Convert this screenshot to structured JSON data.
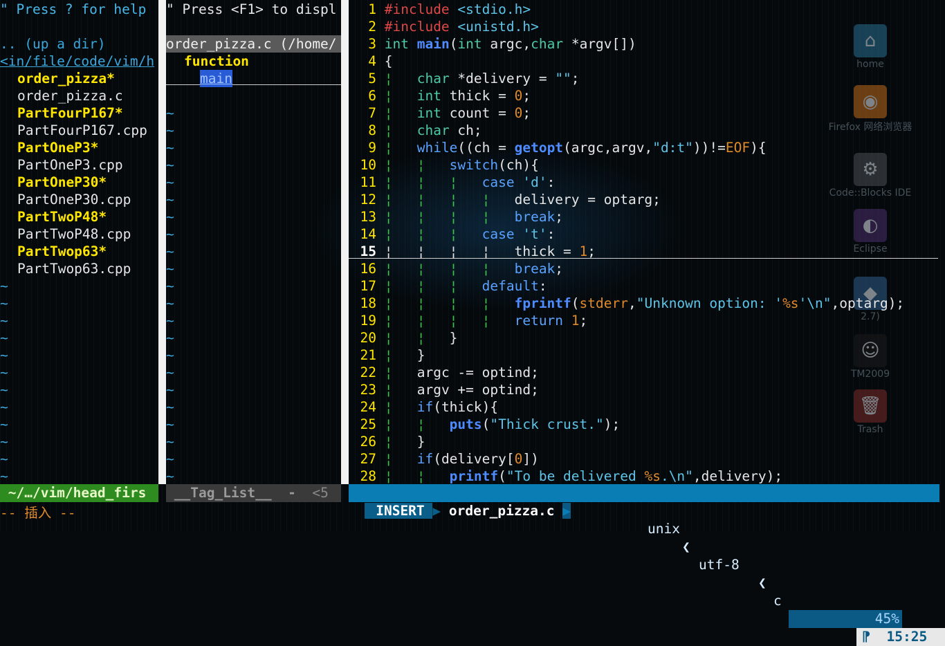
{
  "nerdtree": {
    "help": "\" Press ? for help",
    "up_dir": ".. (up a dir)",
    "cwd": "<in/file/code/vim/h",
    "entries": [
      {
        "name": "order_pizza*",
        "exec": true
      },
      {
        "name": "order_pizza.c",
        "exec": false
      },
      {
        "name": "PartFourP167*",
        "exec": true
      },
      {
        "name": "PartFourP167.cpp",
        "exec": false
      },
      {
        "name": "PartOneP3*",
        "exec": true
      },
      {
        "name": "PartOneP3.cpp",
        "exec": false
      },
      {
        "name": "PartOneP30*",
        "exec": true
      },
      {
        "name": "PartOneP30.cpp",
        "exec": false
      },
      {
        "name": "PartTwoP48*",
        "exec": true
      },
      {
        "name": "PartTwoP48.cpp",
        "exec": false
      },
      {
        "name": "PartTwop63*",
        "exec": true
      },
      {
        "name": "PartTwop63.cpp",
        "exec": false
      }
    ],
    "tilde": "~"
  },
  "taglist": {
    "help": "\" Press <F1> to displ",
    "file": "order_pizza.c (/home/",
    "kind": "function",
    "tag": "main"
  },
  "statusline": {
    "nerdtree_path": " ~/…/vim/head_firs",
    "taglist_name": " __Tag_List__  - ",
    "taglist_pos": " <5",
    "mode": " INSERT ",
    "filename": " order_pizza.c ",
    "fileformat": "unix",
    "encoding": "utf-8",
    "filetype": "c",
    "percent": "45%",
    "position": "15:25"
  },
  "cmdline": "-- 插入 --",
  "desktop_icons": [
    {
      "name": "home-icon",
      "label": "home"
    },
    {
      "name": "firefox-icon",
      "label": "Firefox 网络浏览器"
    },
    {
      "name": "codeblocks-icon",
      "label": "Code::Blocks IDE"
    },
    {
      "name": "eclipse-icon",
      "label": "Eclipse"
    },
    {
      "name": "idle-icon",
      "label": "2.7)"
    },
    {
      "name": "qq-icon",
      "label": "TM2009"
    },
    {
      "name": "trash-icon",
      "label": "Trash"
    }
  ],
  "code": [
    [
      [
        "pre",
        "#include "
      ],
      [
        "str",
        "<stdio.h>"
      ]
    ],
    [
      [
        "pre",
        "#include "
      ],
      [
        "str",
        "<unistd.h>"
      ]
    ],
    [
      [
        "typ",
        "int "
      ],
      [
        "fn",
        "main"
      ],
      [
        "",
        "("
      ],
      [
        "typ",
        "int"
      ],
      [
        "",
        " argc,"
      ],
      [
        "typ",
        "char"
      ],
      [
        "",
        " *argv[])"
      ]
    ],
    [
      [
        "",
        "{"
      ]
    ],
    [
      [
        "guide",
        "¦   "
      ],
      [
        "typ",
        "char"
      ],
      [
        "",
        " *delivery = "
      ],
      [
        "str",
        "\"\""
      ],
      [
        "",
        ";"
      ]
    ],
    [
      [
        "guide",
        "¦   "
      ],
      [
        "typ",
        "int"
      ],
      [
        "",
        " thick = "
      ],
      [
        "num",
        "0"
      ],
      [
        "",
        ";"
      ]
    ],
    [
      [
        "guide",
        "¦   "
      ],
      [
        "typ",
        "int"
      ],
      [
        "",
        " count = "
      ],
      [
        "num",
        "0"
      ],
      [
        "",
        ";"
      ]
    ],
    [
      [
        "guide",
        "¦   "
      ],
      [
        "typ",
        "char"
      ],
      [
        "",
        " ch;"
      ]
    ],
    [
      [
        "guide",
        "¦   "
      ],
      [
        "kw",
        "while"
      ],
      [
        "",
        "((ch = "
      ],
      [
        "fn",
        "getopt"
      ],
      [
        "",
        "(argc,argv,"
      ],
      [
        "str",
        "\"d:t\""
      ],
      [
        "",
        "))!="
      ],
      [
        "const",
        "EOF"
      ],
      [
        "",
        "){"
      ]
    ],
    [
      [
        "guide",
        "¦   ¦   "
      ],
      [
        "kw",
        "switch"
      ],
      [
        "",
        "(ch){"
      ]
    ],
    [
      [
        "guide",
        "¦   ¦   ¦   "
      ],
      [
        "kw",
        "case "
      ],
      [
        "str",
        "'d'"
      ],
      [
        "",
        ":"
      ]
    ],
    [
      [
        "guide",
        "¦   ¦   ¦   ¦   "
      ],
      [
        "",
        "delivery = optarg;"
      ]
    ],
    [
      [
        "guide",
        "¦   ¦   ¦   ¦   "
      ],
      [
        "kw",
        "break"
      ],
      [
        "",
        ";"
      ]
    ],
    [
      [
        "guide",
        "¦   ¦   ¦   "
      ],
      [
        "kw",
        "case "
      ],
      [
        "str",
        "'t'"
      ],
      [
        "",
        ":"
      ]
    ],
    [
      [
        "",
        "¦   ¦   ¦   ¦   thick = "
      ],
      [
        "num",
        "1"
      ],
      [
        "",
        ";"
      ]
    ],
    [
      [
        "guide",
        "¦   ¦   ¦   ¦   "
      ],
      [
        "kw",
        "break"
      ],
      [
        "",
        ";"
      ]
    ],
    [
      [
        "guide",
        "¦   ¦   ¦   "
      ],
      [
        "kw",
        "default"
      ],
      [
        "",
        ":"
      ]
    ],
    [
      [
        "guide",
        "¦   ¦   ¦   ¦   "
      ],
      [
        "fn",
        "fprintf"
      ],
      [
        "",
        "("
      ],
      [
        "num",
        "stderr"
      ],
      [
        "",
        ","
      ],
      [
        "str",
        "\"Unknown option: '"
      ],
      [
        "num",
        "%s"
      ],
      [
        "str",
        "'\\n\""
      ],
      [
        "",
        ",optarg);"
      ]
    ],
    [
      [
        "guide",
        "¦   ¦   ¦   ¦   "
      ],
      [
        "kw",
        "return "
      ],
      [
        "num",
        "1"
      ],
      [
        "",
        ";"
      ]
    ],
    [
      [
        "guide",
        "¦   ¦   "
      ],
      [
        "",
        "}"
      ]
    ],
    [
      [
        "guide",
        "¦   "
      ],
      [
        "",
        "}"
      ]
    ],
    [
      [
        "guide",
        "¦   "
      ],
      [
        "",
        "argc -= optind;"
      ]
    ],
    [
      [
        "guide",
        "¦   "
      ],
      [
        "",
        "argv += optind;"
      ]
    ],
    [
      [
        "guide",
        "¦   "
      ],
      [
        "kw",
        "if"
      ],
      [
        "",
        "(thick){"
      ]
    ],
    [
      [
        "guide",
        "¦   ¦   "
      ],
      [
        "fn",
        "puts"
      ],
      [
        "",
        "("
      ],
      [
        "str",
        "\"Thick crust.\""
      ],
      [
        "",
        ");"
      ]
    ],
    [
      [
        "guide",
        "¦   "
      ],
      [
        "",
        "}"
      ]
    ],
    [
      [
        "guide",
        "¦   "
      ],
      [
        "kw",
        "if"
      ],
      [
        "",
        "(delivery["
      ],
      [
        "num",
        "0"
      ],
      [
        "",
        "])"
      ]
    ],
    [
      [
        "guide",
        "¦   ¦   "
      ],
      [
        "fn",
        "printf"
      ],
      [
        "",
        "("
      ],
      [
        "str",
        "\"To be delivered "
      ],
      [
        "num",
        "%s"
      ],
      [
        "str",
        ".\\n\""
      ],
      [
        "",
        ",delivery);"
      ]
    ]
  ],
  "line_numbers": [
    "1",
    "2",
    "3",
    "4",
    "5",
    "6",
    "7",
    "8",
    "9",
    "10",
    "11",
    "12",
    "13",
    "14",
    "15",
    "16",
    "17",
    "18",
    "19",
    "20",
    "21",
    "22",
    "23",
    "24",
    "25",
    "26",
    "27",
    "28"
  ],
  "cursor_line": 15
}
